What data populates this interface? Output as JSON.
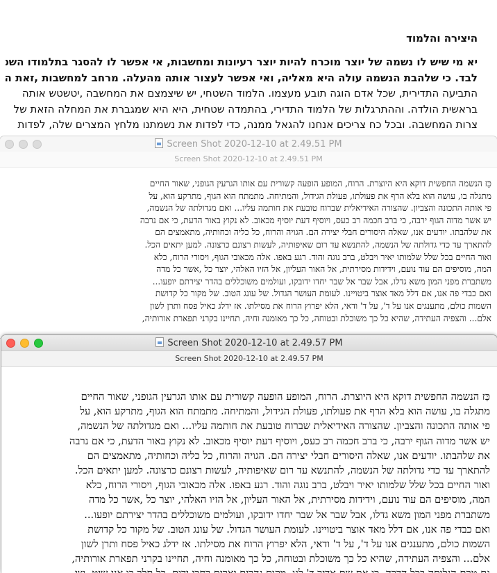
{
  "background_doc": {
    "heading": "היצירה והלמוד",
    "lines": [
      "יא מי שיש לו נשמה של יוצר מוכרח להיות יוצר רעיונות ומחשבות, אי אפשר לו להסגר בתלמודו השטחי",
      "לבד. כי שלהבת הנשמה עולה היא מאליה, ואי אפשר לעצור אותה מהעלה. מרחב למחשבות ,זאת היא",
      "התביעה התדירית, שכל אדם הוגה תובע מעצמו. הלמוד השטחי, יש שיצמצם את המחשבה ,יטשטש אותה",
      "בראשית הולדה. וההתרגלות של הלמוד התדירי, בהתמדה שטחית, היא היא שמגברת את המחלה הזאת של",
      "צרות המחשבה. ובכל כח צריכים אנחנו להגאל ממנה, כדי לפדות את נשמתנו מלחץ המצרים שלה, לפדות"
    ]
  },
  "window1": {
    "title": "Screen Shot 2020-12-10 at 2.49.51 PM",
    "subtitle": "Screen Shot 2020-12-10 at 2.49.51 PM",
    "lines": [
      "כַּז הנשמה החפשית דוקא היא היוצרת. הרוח, המופע הופעה קשורית עם אותו הגרעין הגופני, שאור החיים",
      "מתגלה בו, עושה הוא בלא הרף את פעולתו, פעולת הגידול, והמתיחה. מתמתח הוא הגוף, מתרקע הוא, על",
      "פי אותה התכונה והצביון. שהצורה האידיאלית שברוח טובעת את חותמה עליו... ואם מגדולתה של הנשמה,",
      "יש אשר מדוה הגוף ירבה, כי ברב חכמה רב כעס, ויוסיף דעת יוסיף מכאוב. לא נקוץ באור הדעת, כי אם נרבה",
      "את שלהבתו. יודעים אנו, שאלה היסורים חבלי יצירה הם. הגויה והרוח, כל כליה וכחותיה, מתאמצים הם",
      "להתארך עד כדי גדולתה של הנשמה, להתנשא עד רום שאיפותיה, לעשות רצונם כרצונה. למען יתאים הכל.",
      "ואור החיים בכל שלל שלמותו יאיר ויבלט, ברב נוגה והוד. רגע באפו. אלה מכאובי הגוף, ויסורי הרוח, כלא",
      "המה, מוסיפים הם עוד נועם, וידידות מסירתית, אל האור העליון, אל הזיו האלהי, יוצר כל ,אשר כל מדה",
      "משתברת מפני המון משא גדלו, אבל שבר אל שבר יחדו ידובקו, ועולמים משוכללים בהדר יצירתם יופעו...",
      "ואם כבדי פה אנו, אם דלל מאד אוצר ביטויינו. לעומת העושר הגדול. של עונג הטוב. של מקור כל קדושת",
      "השמות כולם, מתענגים אנו על ד', על ד' ודאי, הלא יפרוץ הרוח את מסילתו. אז ידלג כאיל פסח ותרן לשון",
      "אלם... והצפיה העתידה, שהיא כל כך משוכלת ובטוחה, כל כך מאומנה וחיה, תחיינו בקרני תפארת אורותיה,"
    ]
  },
  "window2": {
    "title": "Screen Shot 2020-12-10 at 2.49.57 PM",
    "subtitle": "Screen Shot 2020-12-10 at 2.49.57 PM",
    "lines": [
      "כַּז הנשמה החפשית דוקא היא היוצרת. הרוח, המופע הופעה קשורית עם אותו הגרעין הגופני, שאור החיים",
      "מתגלה בו, עושה הוא בלא הרף את פעולתו, פעולת הגידול, והמתיחה. מתמתח הוא הגוף, מתרקע הוא, על",
      "פי אותה התכונה והצביון. שהצורה האידיאלית שברוח טובעת את חותמה עליו... ואם מגדולתה של הנשמה,",
      "יש אשר מדוה הגוף ירבה, כי ברב חכמה רב כעס, ויוסיף דעת יוסיף מכאוב. לא נקוץ באור הדעת, כי אם נרבה",
      "את שלהבתו. יודעים אנו, שאלה היסורים חבלי יצירה הם. הגויה והרוח, כל כליה וכחותיה, מתאמצים הם",
      "להתארך עד כדי גדולתה של הנשמה, להתנשא עד רום שאיפותיה, לעשות רצונם כרצונה. למען יתאים הכל.",
      "ואור החיים בכל שלל שלמותו יאיר ויבלט, ברב נוגה והוד. רגע באפו. אלה מכאובי הגוף, ויסורי הרוח, כלא",
      "המה, מוסיפים הם עוד נועם, וידידות מסירתית, אל האור העליון, אל הזיו האלהי, יוצר כל ,אשר כל מדה",
      "משתברת מפני המון משא גדלו, אבל שבר אל שבר יחדו ידובקו, ועולמים משוכללים בהדר יצירתם יופעו...",
      "ואם כבדי פה אנו, אם דלל מאד אוצר ביטויינו. לעומת העושר הגדול. של עונג הטוב. של מקור כל קדושת",
      "השמות כולם, מתענגים אנו על ד', על ד' ודאי, הלא יפרוץ הרוח את מסילתו. אז ידלג כאיל פסח ותרן לשון",
      "אלם... והצפיה העתידה, שהיא כל כך משוכלת ובטוחה, כל כך מאומנה וחיה, תחיינו בקרני תפארת אורותיה,",
      "גם טרם הגלותה בכל הדרה. כי אם שם אדיר ד' לנו, מקום נהרים יארים רחבי ידים, בל תלך בו אני שיט, וצי"
    ]
  }
}
